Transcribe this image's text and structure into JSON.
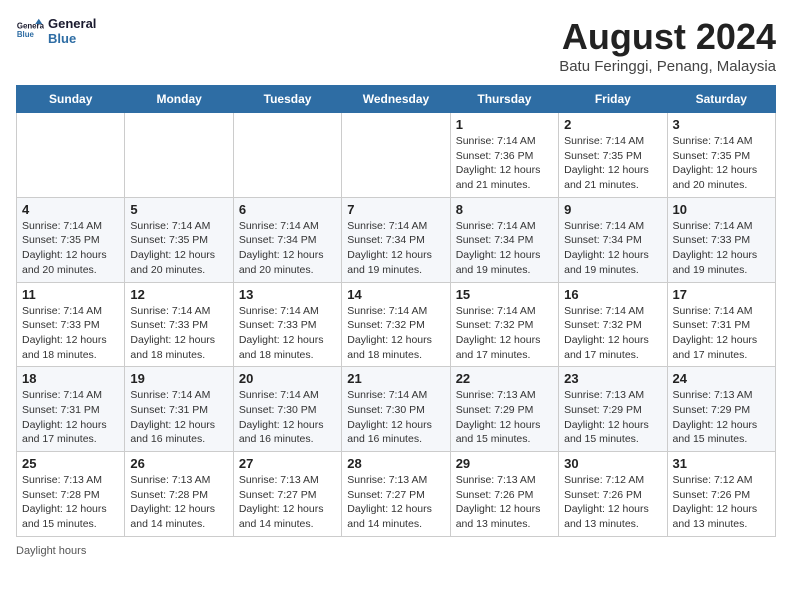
{
  "header": {
    "logo_line1": "General",
    "logo_line2": "Blue",
    "month": "August 2024",
    "location": "Batu Feringgi, Penang, Malaysia"
  },
  "days_of_week": [
    "Sunday",
    "Monday",
    "Tuesday",
    "Wednesday",
    "Thursday",
    "Friday",
    "Saturday"
  ],
  "footer": {
    "note": "Daylight hours"
  },
  "weeks": [
    [
      {
        "day": "",
        "info": ""
      },
      {
        "day": "",
        "info": ""
      },
      {
        "day": "",
        "info": ""
      },
      {
        "day": "",
        "info": ""
      },
      {
        "day": "1",
        "info": "Sunrise: 7:14 AM\nSunset: 7:36 PM\nDaylight: 12 hours\nand 21 minutes."
      },
      {
        "day": "2",
        "info": "Sunrise: 7:14 AM\nSunset: 7:35 PM\nDaylight: 12 hours\nand 21 minutes."
      },
      {
        "day": "3",
        "info": "Sunrise: 7:14 AM\nSunset: 7:35 PM\nDaylight: 12 hours\nand 20 minutes."
      }
    ],
    [
      {
        "day": "4",
        "info": "Sunrise: 7:14 AM\nSunset: 7:35 PM\nDaylight: 12 hours\nand 20 minutes."
      },
      {
        "day": "5",
        "info": "Sunrise: 7:14 AM\nSunset: 7:35 PM\nDaylight: 12 hours\nand 20 minutes."
      },
      {
        "day": "6",
        "info": "Sunrise: 7:14 AM\nSunset: 7:34 PM\nDaylight: 12 hours\nand 20 minutes."
      },
      {
        "day": "7",
        "info": "Sunrise: 7:14 AM\nSunset: 7:34 PM\nDaylight: 12 hours\nand 19 minutes."
      },
      {
        "day": "8",
        "info": "Sunrise: 7:14 AM\nSunset: 7:34 PM\nDaylight: 12 hours\nand 19 minutes."
      },
      {
        "day": "9",
        "info": "Sunrise: 7:14 AM\nSunset: 7:34 PM\nDaylight: 12 hours\nand 19 minutes."
      },
      {
        "day": "10",
        "info": "Sunrise: 7:14 AM\nSunset: 7:33 PM\nDaylight: 12 hours\nand 19 minutes."
      }
    ],
    [
      {
        "day": "11",
        "info": "Sunrise: 7:14 AM\nSunset: 7:33 PM\nDaylight: 12 hours\nand 18 minutes."
      },
      {
        "day": "12",
        "info": "Sunrise: 7:14 AM\nSunset: 7:33 PM\nDaylight: 12 hours\nand 18 minutes."
      },
      {
        "day": "13",
        "info": "Sunrise: 7:14 AM\nSunset: 7:33 PM\nDaylight: 12 hours\nand 18 minutes."
      },
      {
        "day": "14",
        "info": "Sunrise: 7:14 AM\nSunset: 7:32 PM\nDaylight: 12 hours\nand 18 minutes."
      },
      {
        "day": "15",
        "info": "Sunrise: 7:14 AM\nSunset: 7:32 PM\nDaylight: 12 hours\nand 17 minutes."
      },
      {
        "day": "16",
        "info": "Sunrise: 7:14 AM\nSunset: 7:32 PM\nDaylight: 12 hours\nand 17 minutes."
      },
      {
        "day": "17",
        "info": "Sunrise: 7:14 AM\nSunset: 7:31 PM\nDaylight: 12 hours\nand 17 minutes."
      }
    ],
    [
      {
        "day": "18",
        "info": "Sunrise: 7:14 AM\nSunset: 7:31 PM\nDaylight: 12 hours\nand 17 minutes."
      },
      {
        "day": "19",
        "info": "Sunrise: 7:14 AM\nSunset: 7:31 PM\nDaylight: 12 hours\nand 16 minutes."
      },
      {
        "day": "20",
        "info": "Sunrise: 7:14 AM\nSunset: 7:30 PM\nDaylight: 12 hours\nand 16 minutes."
      },
      {
        "day": "21",
        "info": "Sunrise: 7:14 AM\nSunset: 7:30 PM\nDaylight: 12 hours\nand 16 minutes."
      },
      {
        "day": "22",
        "info": "Sunrise: 7:13 AM\nSunset: 7:29 PM\nDaylight: 12 hours\nand 15 minutes."
      },
      {
        "day": "23",
        "info": "Sunrise: 7:13 AM\nSunset: 7:29 PM\nDaylight: 12 hours\nand 15 minutes."
      },
      {
        "day": "24",
        "info": "Sunrise: 7:13 AM\nSunset: 7:29 PM\nDaylight: 12 hours\nand 15 minutes."
      }
    ],
    [
      {
        "day": "25",
        "info": "Sunrise: 7:13 AM\nSunset: 7:28 PM\nDaylight: 12 hours\nand 15 minutes."
      },
      {
        "day": "26",
        "info": "Sunrise: 7:13 AM\nSunset: 7:28 PM\nDaylight: 12 hours\nand 14 minutes."
      },
      {
        "day": "27",
        "info": "Sunrise: 7:13 AM\nSunset: 7:27 PM\nDaylight: 12 hours\nand 14 minutes."
      },
      {
        "day": "28",
        "info": "Sunrise: 7:13 AM\nSunset: 7:27 PM\nDaylight: 12 hours\nand 14 minutes."
      },
      {
        "day": "29",
        "info": "Sunrise: 7:13 AM\nSunset: 7:26 PM\nDaylight: 12 hours\nand 13 minutes."
      },
      {
        "day": "30",
        "info": "Sunrise: 7:12 AM\nSunset: 7:26 PM\nDaylight: 12 hours\nand 13 minutes."
      },
      {
        "day": "31",
        "info": "Sunrise: 7:12 AM\nSunset: 7:26 PM\nDaylight: 12 hours\nand 13 minutes."
      }
    ]
  ]
}
